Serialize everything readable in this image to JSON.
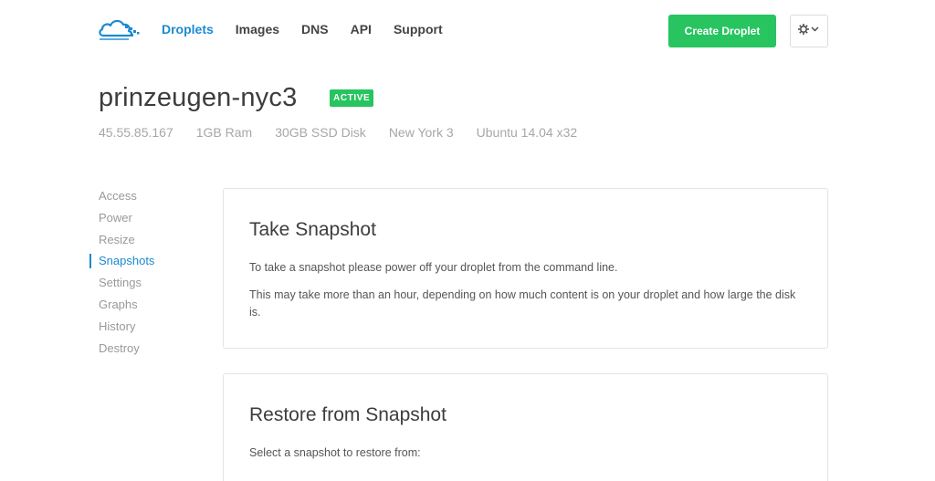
{
  "nav": {
    "items": [
      {
        "label": "Droplets",
        "active": true
      },
      {
        "label": "Images",
        "active": false
      },
      {
        "label": "DNS",
        "active": false
      },
      {
        "label": "API",
        "active": false
      },
      {
        "label": "Support",
        "active": false
      }
    ]
  },
  "header": {
    "create_label": "Create Droplet",
    "settings_icon": "gear-icon"
  },
  "droplet": {
    "name": "prinzeugen-nyc3",
    "status": "ACTIVE",
    "ip": "45.55.85.167",
    "ram": "1GB Ram",
    "disk": "30GB SSD Disk",
    "region": "New York 3",
    "image": "Ubuntu 14.04 x32"
  },
  "sidebar": {
    "items": [
      {
        "label": "Access"
      },
      {
        "label": "Power"
      },
      {
        "label": "Resize"
      },
      {
        "label": "Snapshots",
        "active": true
      },
      {
        "label": "Settings"
      },
      {
        "label": "Graphs"
      },
      {
        "label": "History"
      },
      {
        "label": "Destroy"
      }
    ]
  },
  "take_snapshot": {
    "title": "Take Snapshot",
    "line1": "To take a snapshot please power off your droplet from the command line.",
    "line2": "This may take more than an hour, depending on how much content is on your droplet and how large the disk is."
  },
  "restore_snapshot": {
    "title": "Restore from Snapshot",
    "line1": "Select a snapshot to restore from:"
  },
  "colors": {
    "accent": "#1a8ad1",
    "success": "#27c460"
  }
}
